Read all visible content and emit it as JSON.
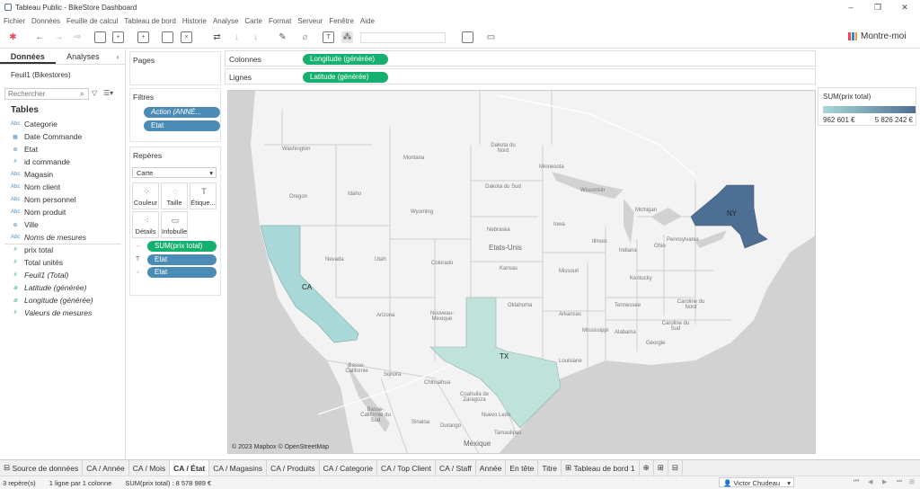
{
  "window": {
    "title": "Tableau Public - BikeStore Dashboard"
  },
  "menu": [
    "Fichier",
    "Données",
    "Feuille de calcul",
    "Tableau de bord",
    "Historie",
    "Analyse",
    "Carte",
    "Format",
    "Serveur",
    "Fenêtre",
    "Aide"
  ],
  "toolbar": {
    "show_me": "Montre-moi"
  },
  "left": {
    "tab_data": "Données",
    "tab_analytics": "Analyses",
    "collapse": "‹",
    "source": "Feuil1 (Bikestores)",
    "search_placeholder": "Rechercher",
    "tables_heading": "Tables",
    "dimensions": [
      {
        "type": "Abc",
        "label": "Categorie",
        "italic": false
      },
      {
        "type": "cal",
        "label": "Date Commande",
        "italic": false
      },
      {
        "type": "geo",
        "label": "Etat",
        "italic": false
      },
      {
        "type": "#",
        "label": "id commande",
        "italic": false
      },
      {
        "type": "Abc",
        "label": "Magasin",
        "italic": false
      },
      {
        "type": "Abc",
        "label": "Nom client",
        "italic": false
      },
      {
        "type": "Abc",
        "label": "Nom personnel",
        "italic": false
      },
      {
        "type": "Abc",
        "label": "Nom produit",
        "italic": false
      },
      {
        "type": "geo",
        "label": "Ville",
        "italic": false
      },
      {
        "type": "Abc",
        "label": "Noms de mesures",
        "italic": true
      }
    ],
    "measures": [
      {
        "type": "#",
        "label": "prix total",
        "italic": false
      },
      {
        "type": "#",
        "label": "Total unités",
        "italic": false
      },
      {
        "type": "#",
        "label": "Feuil1 (Total)",
        "italic": true
      },
      {
        "type": "geo",
        "label": "Latitude (générée)",
        "italic": true
      },
      {
        "type": "geo",
        "label": "Longitude (générée)",
        "italic": true
      },
      {
        "type": "#",
        "label": "Valeurs de mesures",
        "italic": true
      }
    ]
  },
  "cards": {
    "pages": "Pages",
    "filters": "Filtres",
    "filter_pills": [
      "Action (ANNÉ...",
      "Etat"
    ],
    "marks": "Repères",
    "mark_type": "Carte",
    "mark_buttons": [
      "Couleur",
      "Taille",
      "Étique...",
      "Détails",
      "Infobulle"
    ],
    "mark_pills": [
      "SUM(prix total)",
      "Etat",
      "Etat"
    ]
  },
  "shelves": {
    "columns": "Colonnes",
    "columns_pill": "Longitude (générée)",
    "rows": "Lignes",
    "rows_pill": "Latitude (générée)"
  },
  "map": {
    "copyright": "© 2023 Mapbox © OpenStreetMap",
    "state_labels": [
      "CA",
      "TX",
      "NY"
    ],
    "state_colors": {
      "CA": "#a9d8d8",
      "TX": "#bfe3da",
      "NY": "#4e6f94"
    },
    "base_labels": {
      "country": "Etats-Unis",
      "mexico": "Mexique",
      "washington": "Washington",
      "oregon": "Oregon",
      "idaho": "Idaho",
      "montana": "Montana",
      "wyoming": "Wyoming",
      "nevada": "Nevada",
      "utah": "Utah",
      "colorado": "Colorado",
      "arizona": "Arizona",
      "nm": "Nouveau-Mexique",
      "nd": "Dakota du Nord",
      "sd": "Dakota du Sud",
      "nebraska": "Nebraska",
      "kansas": "Kansas",
      "oklahoma": "Oklahoma",
      "minnesota": "Minnesota",
      "iowa": "Iowa",
      "missouri": "Missouri",
      "arkansas": "Arkansas",
      "louisiana": "Louisiane",
      "wisconsin": "Wisconsin",
      "illinois": "Illinois",
      "michigan": "Michigan",
      "indiana": "Indiana",
      "ohio": "Ohio",
      "kentucky": "Kentucky",
      "tennessee": "Tennessee",
      "mississippi": "Mississippi",
      "alabama": "Alabama",
      "georgia": "Géorgie",
      "pennsylvania": "Pennsylvania",
      "nc": "Caroline du Nord",
      "sc": "Caroline du Sud",
      "bc": "Basse-Californie",
      "bcs": "Basse-Californie du Sud",
      "sonora": "Sonora",
      "chihuahua": "Chihuahua",
      "coahuila": "Coahuila de Zaragoza",
      "nl": "Nuevo León",
      "tamaulipas": "Tamaulipas",
      "sinaloa": "Sinaloa",
      "durango": "Durango"
    }
  },
  "legend": {
    "title": "SUM(prix total)",
    "min": "962 601 €",
    "max": "5 826 242 €"
  },
  "sheets": [
    "Source de données",
    "CA / Année",
    "CA / Mois",
    "CA / État",
    "CA / Magasins",
    "CA / Produits",
    "CA / Categorie",
    "CA / Top Client",
    "CA / Staff",
    "Année",
    "En tête",
    "Titre",
    "Tableau de bord 1"
  ],
  "active_sheet": "CA / État",
  "status": {
    "marks": "3 repère(s)",
    "rows": "1 ligne par 1 colonne",
    "sum": "SUM(prix total) : 8 578 989 €",
    "user": "Victor Chudeau"
  }
}
